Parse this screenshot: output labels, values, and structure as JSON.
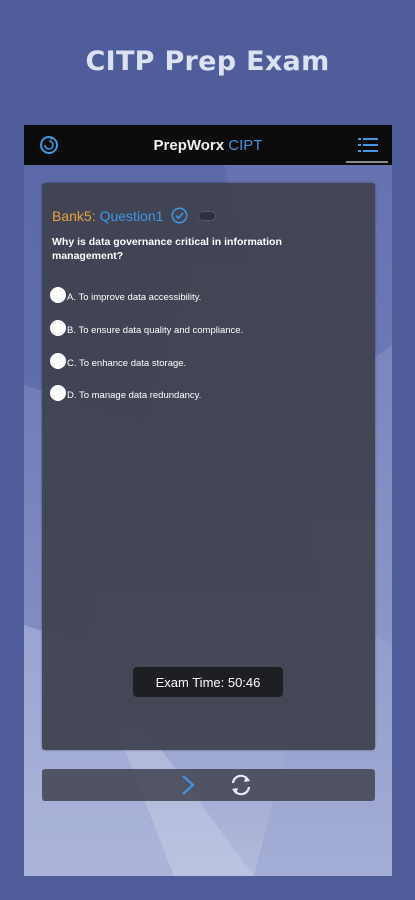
{
  "promo": {
    "title": "CITP Prep Exam"
  },
  "appbar": {
    "title_main": "PrepWorx",
    "title_accent": "CIPT",
    "refresh_icon": "refresh-icon",
    "menu_icon": "menu-list-icon"
  },
  "question": {
    "bank": "Bank5:",
    "number": "Question1",
    "text": "Why is data governance critical in information management?",
    "options": [
      "A. To improve data accessibility.",
      "B. To ensure data quality and compliance.",
      "C. To enhance data storage.",
      "D. To manage data redundancy."
    ]
  },
  "timer": {
    "label": "Exam Time: 50:46"
  },
  "colors": {
    "accent_blue": "#3f97e2",
    "bank_orange": "#e8a23a",
    "page_bg": "#4f5d9a",
    "appbar_bg": "#0b0b0c",
    "card_bg": "#3f424f"
  },
  "bottom": {
    "next_icon": "chevron-right-icon",
    "reload_icon": "reload-icon"
  }
}
